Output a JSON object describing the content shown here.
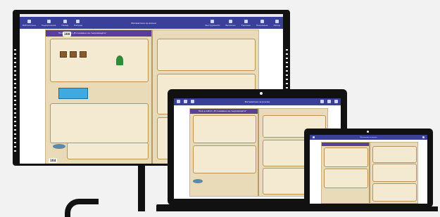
{
  "board": {
    "app_title": "Математика за всички",
    "toolbar_left": [
      "Библиотека",
      "Съдържание",
      "Назад",
      "Напред"
    ],
    "toolbar_right": [
      "Инструменти",
      "Бележки",
      "Търсене",
      "Показване",
      "Изход"
    ],
    "left_page_number": "100",
    "right_page_number": "104",
    "header_text": "Tova e ostrov „В очакване на съкровищата“"
  },
  "laptop": {
    "app_title": "Математика за всички",
    "header_text": "Tova e ostrov „В очакване на съкровищата“"
  },
  "small_laptop": {
    "app_title": "Математика за всички"
  }
}
